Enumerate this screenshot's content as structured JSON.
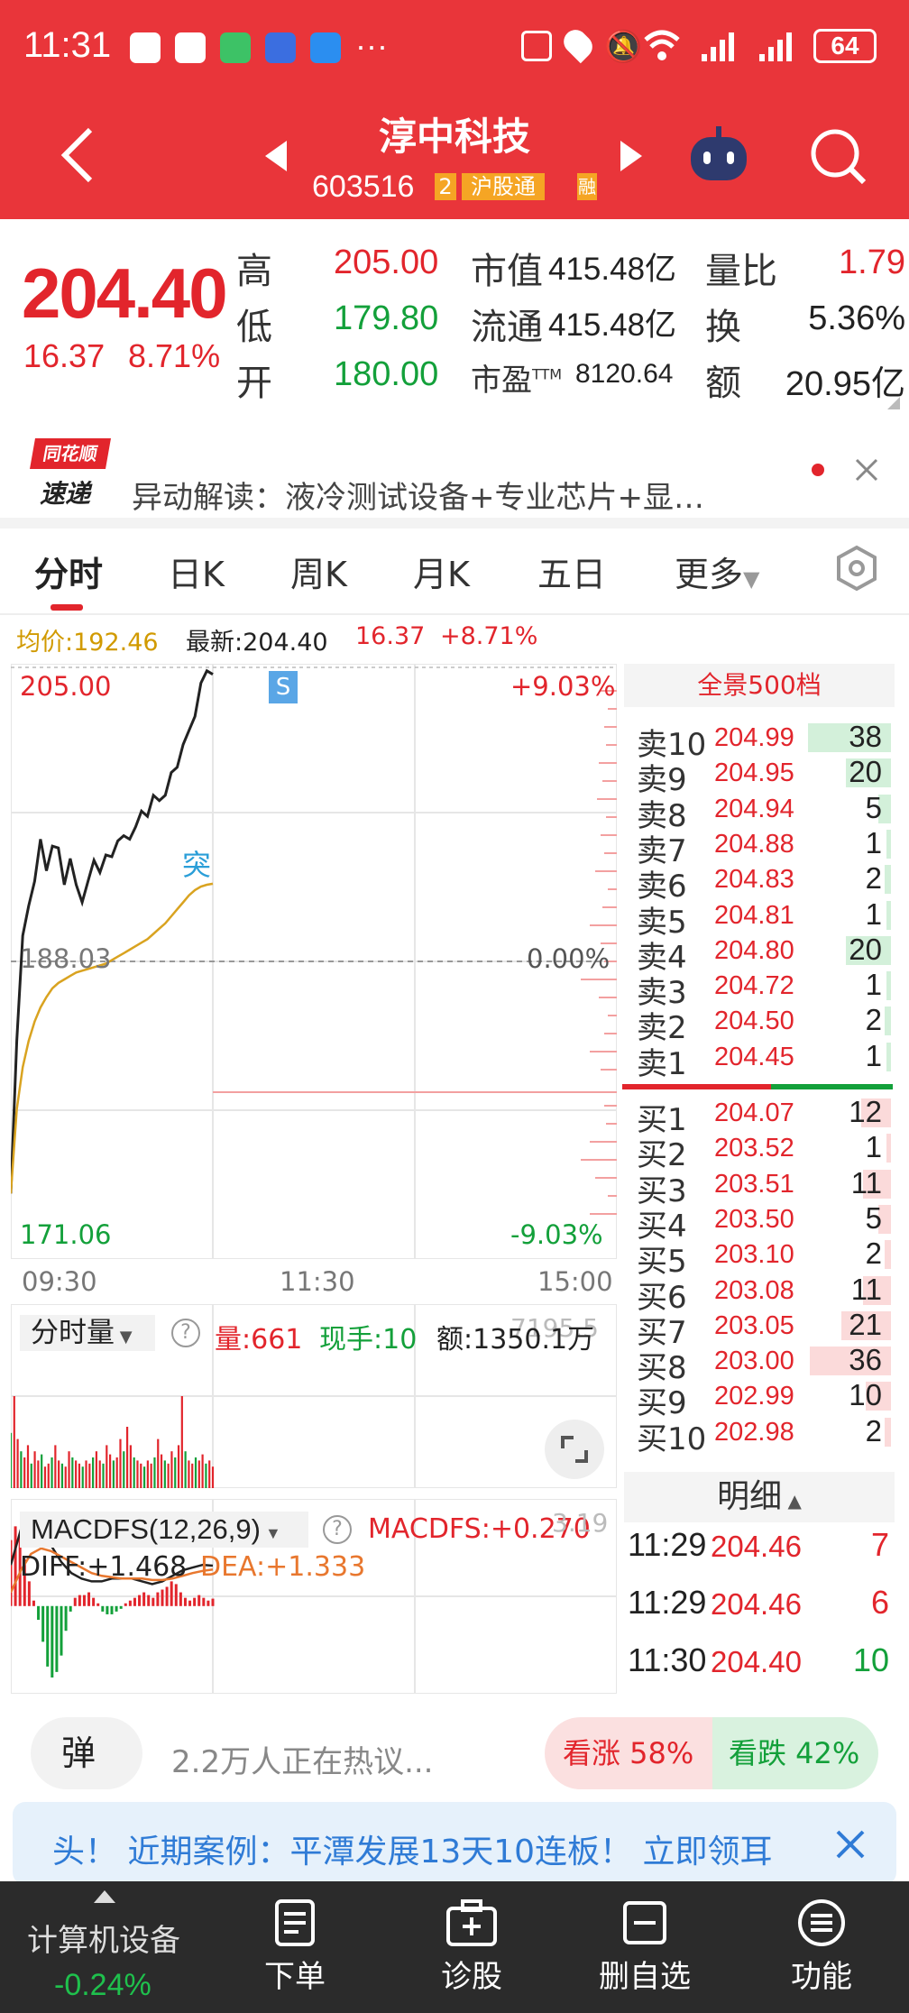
{
  "status": {
    "time": "11:31",
    "battery": "64",
    "more": "···"
  },
  "header": {
    "title": "淳中科技",
    "code": "603516",
    "badge_num": "2",
    "badge_label": "沪股通",
    "badge_clip": "融"
  },
  "quote": {
    "price": "204.40",
    "change": "16.37",
    "pct": "8.71%",
    "high_label": "高",
    "high": "205.00",
    "low_label": "低",
    "low": "179.80",
    "open_label": "开",
    "open": "180.00",
    "cap_label": "市值",
    "cap": "415.48亿",
    "float_label": "流通",
    "float": "415.48亿",
    "pe_label": "市盈",
    "pe_sup": "TTM",
    "pe": "8120.64",
    "vr_label": "量比",
    "vr": "1.79",
    "tr_label": "换",
    "tr": "5.36%",
    "amt_label": "额",
    "amt": "20.95亿"
  },
  "news": {
    "logo_top": "同花顺",
    "logo_bottom": "速递",
    "text": "异动解读：液冷测试设备+专业芯片+显…"
  },
  "tabs": [
    {
      "label": "分时"
    },
    {
      "label": "日K"
    },
    {
      "label": "周K"
    },
    {
      "label": "月K"
    },
    {
      "label": "五日"
    },
    {
      "label": "更多"
    }
  ],
  "infobar": {
    "avg_label": "均价:",
    "avg": "192.46",
    "latest_label": "最新:",
    "latest": "204.40",
    "chg": "16.37",
    "pct": "+8.71%"
  },
  "chart": {
    "top": "205.00",
    "top_pct": "+9.03%",
    "mid": "188.03",
    "mid_pct": "0.00%",
    "bottom": "171.06",
    "bottom_pct": "-9.03%",
    "times": [
      "09:30",
      "11:30",
      "15:00"
    ],
    "flag_s": "S",
    "flag_break": "突"
  },
  "chart_data": [
    {
      "type": "line",
      "title": "",
      "x_range": [
        "09:30",
        "15:00"
      ],
      "ylim": [
        171.06,
        205.0
      ],
      "prev_close": 188.03,
      "series": [
        {
          "name": "",
          "values": [
            174.8,
            183.5,
            189.5,
            191.2,
            192.6,
            195.0,
            193.2,
            194.6,
            194.5,
            192.4,
            193.9,
            192.4,
            191.4,
            192.6,
            193.8,
            193.1,
            194.1,
            194.0,
            194.9,
            195.2,
            195.0,
            195.7,
            196.6,
            196.3,
            197.5,
            197.2,
            197.5,
            198.8,
            199.1,
            200.4,
            201.2,
            202.0,
            203.9,
            204.6,
            204.4
          ]
        },
        {
          "name": "",
          "values": [
            174.8,
            179.6,
            182.0,
            183.5,
            184.6,
            185.4,
            186.0,
            186.5,
            186.8,
            187.0,
            187.2,
            187.4,
            187.5,
            187.6,
            187.7,
            187.8,
            187.9,
            188.1,
            188.3,
            188.5,
            188.7,
            188.9,
            189.1,
            189.3,
            189.6,
            189.9,
            190.2,
            190.6,
            191.0,
            191.4,
            191.8,
            192.1,
            192.3,
            192.4,
            192.46
          ]
        }
      ]
    },
    {
      "type": "bar",
      "title": "",
      "series": [
        {
          "name": "量",
          "values": [
            18,
            30,
            16,
            12,
            10,
            14,
            8,
            12,
            9,
            11,
            7,
            8,
            10,
            14,
            9,
            8,
            7,
            12,
            10,
            9,
            8,
            7,
            9,
            8,
            10,
            12,
            9,
            8,
            14,
            11,
            9,
            10,
            16,
            12,
            20,
            14,
            10,
            9,
            8,
            7,
            9,
            8,
            10,
            16,
            11,
            9,
            8,
            12,
            10,
            14,
            30,
            12,
            9,
            8,
            10,
            9,
            11,
            8,
            9,
            7
          ]
        }
      ],
      "ymax": 45
    },
    {
      "type": "bar",
      "title": "",
      "series": [
        {
          "name": "MACDFS",
          "values": [
            2.4,
            2.9,
            2.6,
            1.7,
            0.9,
            0.2,
            -0.5,
            -1.3,
            -2.2,
            -2.6,
            -2.4,
            -1.8,
            -0.9,
            -0.2,
            0.3,
            0.4,
            0.4,
            0.5,
            0.3,
            0.1,
            -0.2,
            -0.3,
            -0.3,
            -0.2,
            -0.1,
            0.1,
            0.2,
            0.3,
            0.4,
            0.5,
            0.4,
            0.3,
            0.5,
            0.6,
            0.7,
            0.9,
            0.8,
            0.5,
            0.3,
            0.2,
            0.3,
            0.4,
            0.3,
            0.2,
            0.27
          ]
        },
        {
          "name": "DIFF",
          "values": [
            1.5,
            2.8,
            3.1,
            2.8,
            2.2,
            1.6,
            1.2,
            1.0,
            0.9,
            0.9,
            1.0,
            1.0,
            1.0,
            0.9,
            0.8,
            0.9,
            1.1,
            1.3,
            1.4,
            1.5,
            1.47
          ]
        },
        {
          "name": "DEA",
          "values": [
            0.5,
            1.3,
            1.9,
            2.1,
            2.0,
            1.8,
            1.6,
            1.4,
            1.2,
            1.1,
            1.05,
            1.0,
            1.0,
            1.0,
            0.95,
            0.95,
            1.0,
            1.1,
            1.2,
            1.28,
            1.33
          ]
        }
      ],
      "ymax": 3.19
    }
  ],
  "orderbook": {
    "header": "全景500档",
    "sells": [
      {
        "label": "卖10",
        "price": "204.99",
        "vol": "38",
        "w": 0.92
      },
      {
        "label": "卖9",
        "price": "204.95",
        "vol": "20",
        "w": 0.5
      },
      {
        "label": "卖8",
        "price": "204.94",
        "vol": "5",
        "w": 0.14
      },
      {
        "label": "卖7",
        "price": "204.88",
        "vol": "1",
        "w": 0.05
      },
      {
        "label": "卖6",
        "price": "204.83",
        "vol": "2",
        "w": 0.07
      },
      {
        "label": "卖5",
        "price": "204.81",
        "vol": "1",
        "w": 0.05
      },
      {
        "label": "卖4",
        "price": "204.80",
        "vol": "20",
        "w": 0.5
      },
      {
        "label": "卖3",
        "price": "204.72",
        "vol": "1",
        "w": 0.05
      },
      {
        "label": "卖2",
        "price": "204.50",
        "vol": "2",
        "w": 0.07
      },
      {
        "label": "卖1",
        "price": "204.45",
        "vol": "1",
        "w": 0.05
      }
    ],
    "buys": [
      {
        "label": "买1",
        "price": "204.07",
        "vol": "12",
        "w": 0.33
      },
      {
        "label": "买2",
        "price": "203.52",
        "vol": "1",
        "w": 0.05
      },
      {
        "label": "买3",
        "price": "203.51",
        "vol": "11",
        "w": 0.31
      },
      {
        "label": "买4",
        "price": "203.50",
        "vol": "5",
        "w": 0.14
      },
      {
        "label": "买5",
        "price": "203.10",
        "vol": "2",
        "w": 0.07
      },
      {
        "label": "买6",
        "price": "203.08",
        "vol": "11",
        "w": 0.31
      },
      {
        "label": "买7",
        "price": "203.05",
        "vol": "21",
        "w": 0.55
      },
      {
        "label": "买8",
        "price": "203.00",
        "vol": "36",
        "w": 0.9
      },
      {
        "label": "买9",
        "price": "202.99",
        "vol": "10",
        "w": 0.28
      },
      {
        "label": "买10",
        "price": "202.98",
        "vol": "2",
        "w": 0.07
      }
    ]
  },
  "detail": {
    "header": "明细",
    "rows": [
      {
        "time": "11:29",
        "price": "204.46",
        "vol": "7"
      },
      {
        "time": "11:29",
        "price": "204.46",
        "vol": "6"
      },
      {
        "time": "11:30",
        "price": "204.40",
        "vol": "10"
      }
    ]
  },
  "volume": {
    "selector": "分时量",
    "vol_label": "量:",
    "vol": "661",
    "hand_label": "现手:",
    "hand": "10",
    "amt_label": "额:",
    "amt": "1350.1万",
    "max": "7195.5"
  },
  "macd": {
    "selector": "MACDFS(12,26,9)",
    "macdfs_label": "MACDFS:",
    "macdfs": "+0.270",
    "diff_label": "DIFF:",
    "diff": "+1.468",
    "dea_label": "DEA:",
    "dea": "+1.333",
    "max": "3.19"
  },
  "discuss": {
    "danmu": "弹",
    "text": "2.2万人正在热议...",
    "up": "看涨 58%",
    "down": "看跌 42%"
  },
  "banner": {
    "text": "头！ 近期案例：平潭发展13天10连板！ 立即领耳"
  },
  "bottomnav": {
    "sector": "计算机设备",
    "sector_pct": "-0.24%",
    "items": [
      {
        "label": "下单"
      },
      {
        "label": "诊股"
      },
      {
        "label": "删自选"
      },
      {
        "label": "功能"
      }
    ]
  }
}
